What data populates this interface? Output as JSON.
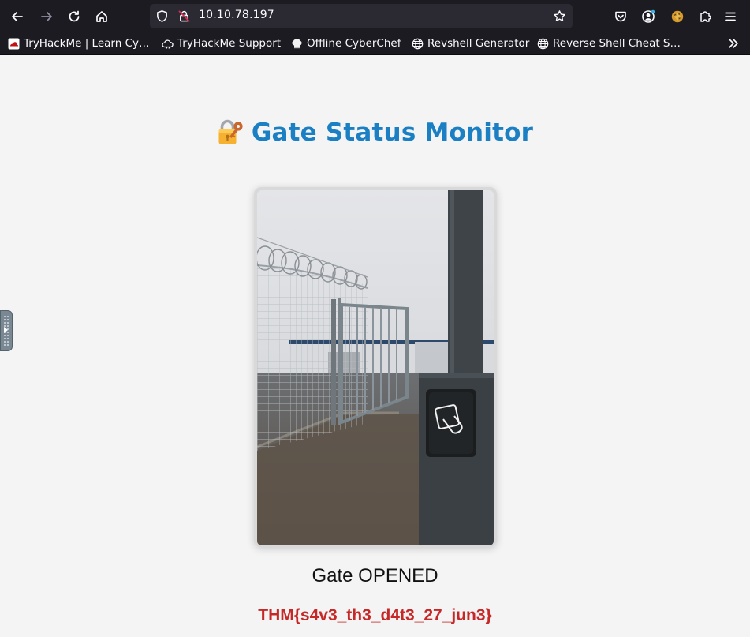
{
  "browser": {
    "url": "10.10.78.197",
    "bookmarks": [
      {
        "label": "TryHackMe | Learn Cy…",
        "icon": "tryhackme-icon"
      },
      {
        "label": "TryHackMe Support",
        "icon": "cloud-icon"
      },
      {
        "label": "Offline CyberChef",
        "icon": "chef-hat-icon"
      },
      {
        "label": "Revshell Generator",
        "icon": "globe-icon"
      },
      {
        "label": "Reverse Shell Cheat S…",
        "icon": "globe-icon"
      }
    ]
  },
  "page": {
    "title": "Gate Status Monitor",
    "title_icon": "lock-with-key-icon",
    "image_subject": "gate-photo",
    "status": "Gate OPENED",
    "flag": "THM{s4v3_th3_d4t3_27_jun3}"
  },
  "colors": {
    "title": "#1a7fc3",
    "flag": "#c62828",
    "page_background": "#f4f4f4",
    "chrome": "#1c1b22",
    "urlbar": "#2b2a33"
  }
}
